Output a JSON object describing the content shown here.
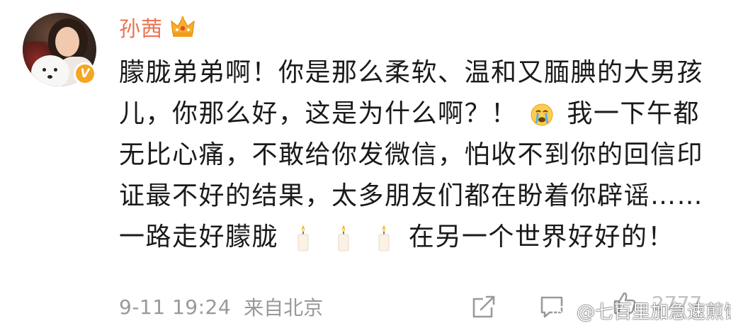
{
  "user": {
    "name": "孙茜",
    "verified_badge": "v-badge-icon",
    "membership_icon": "crown-icon"
  },
  "post": {
    "text_parts": [
      "朦胧弟弟啊！你是那么柔软、温和又腼腆的大男孩儿，你那么好，这是为什么啊？！",
      "我一下午都无比心痛，不敢给你发微信，怕收不到你的回信印证最不好的结果，太多朋友们都在盼着你辟谣…… 一路走好朦胧",
      "在另一个世界好好的！"
    ],
    "emojis": [
      "crying-face-icon",
      "candle-icon",
      "candle-icon",
      "candle-icon"
    ]
  },
  "meta": {
    "time": "9-11 19:24",
    "source": "来自北京"
  },
  "actions": {
    "share": "share-icon",
    "comment": "comment-icon",
    "like": "like-icon",
    "like_count": "2777"
  },
  "watermark": {
    "text": "@七百里加急速煎饼"
  },
  "colors": {
    "username": "#eb7350",
    "text": "#1a1a1a",
    "meta": "#999999",
    "verified": "#f5a623"
  }
}
